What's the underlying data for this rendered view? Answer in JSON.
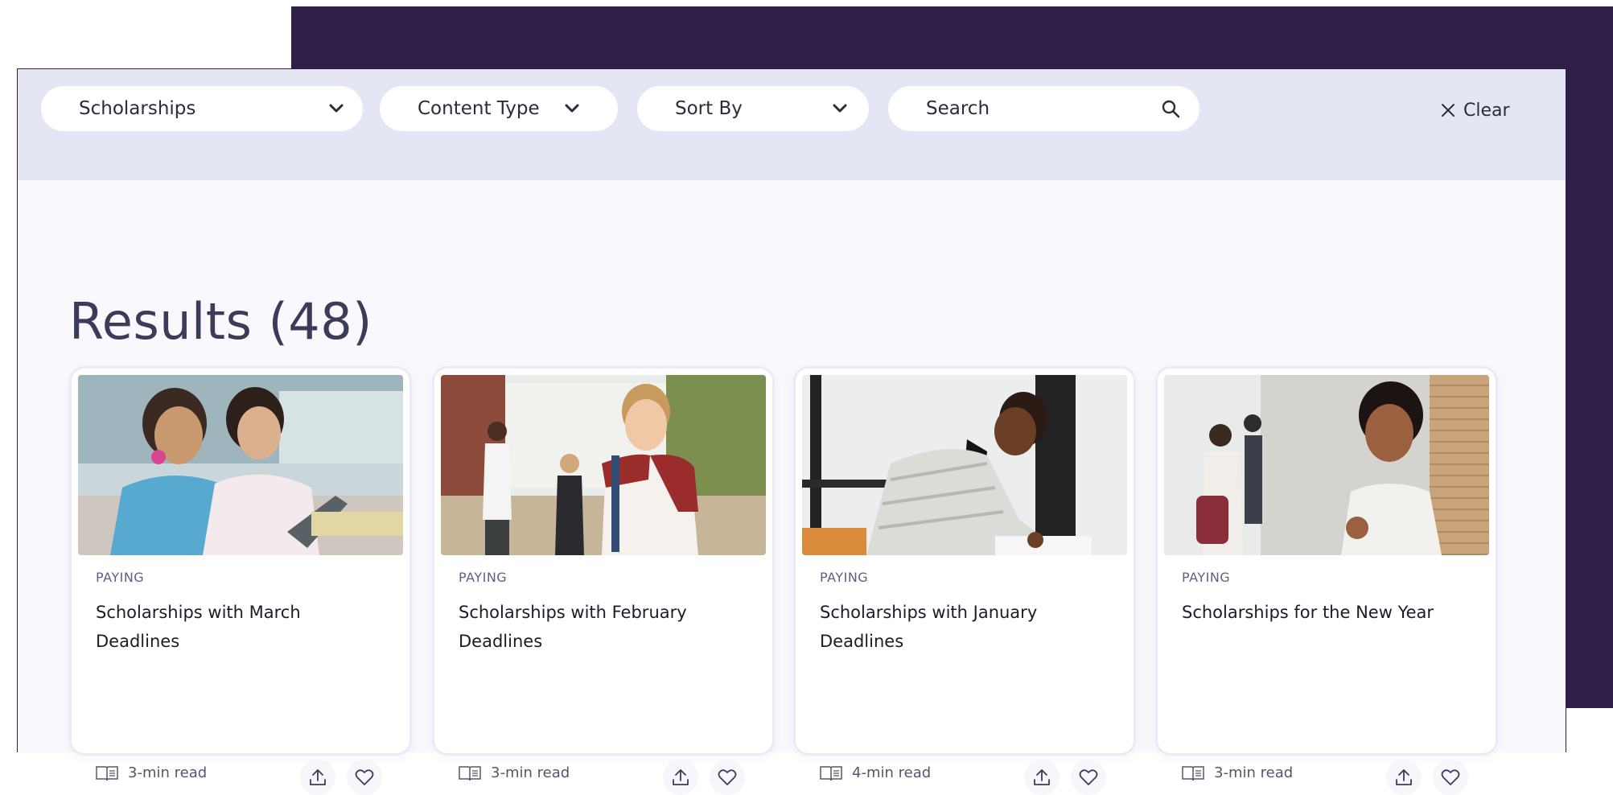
{
  "filters": {
    "category": {
      "label": "Scholarships"
    },
    "content_type": {
      "label": "Content Type"
    },
    "sort_by": {
      "label": "Sort By"
    },
    "search": {
      "placeholder": "Search",
      "value": ""
    },
    "clear_label": "Clear"
  },
  "results": {
    "title": "Results (48)",
    "cards": [
      {
        "tag": "PAYING",
        "title": "Scholarships with March Deadlines",
        "read_time": "3-min read"
      },
      {
        "tag": "PAYING",
        "title": "Scholarships with February Deadlines",
        "read_time": "3-min read"
      },
      {
        "tag": "PAYING",
        "title": "Scholarships with January Deadlines",
        "read_time": "4-min read"
      },
      {
        "tag": "PAYING",
        "title": "Scholarships for the New Year",
        "read_time": "3-min read"
      }
    ]
  },
  "icons": [
    "chevron-down-icon",
    "search-icon",
    "close-icon",
    "book-icon",
    "share-icon",
    "heart-icon"
  ],
  "colors": {
    "brand_purple": "#2f1e45",
    "filter_bar": "#e5e6f3",
    "page_bg": "#f8f8fd",
    "tag_text": "#5d5f86"
  }
}
